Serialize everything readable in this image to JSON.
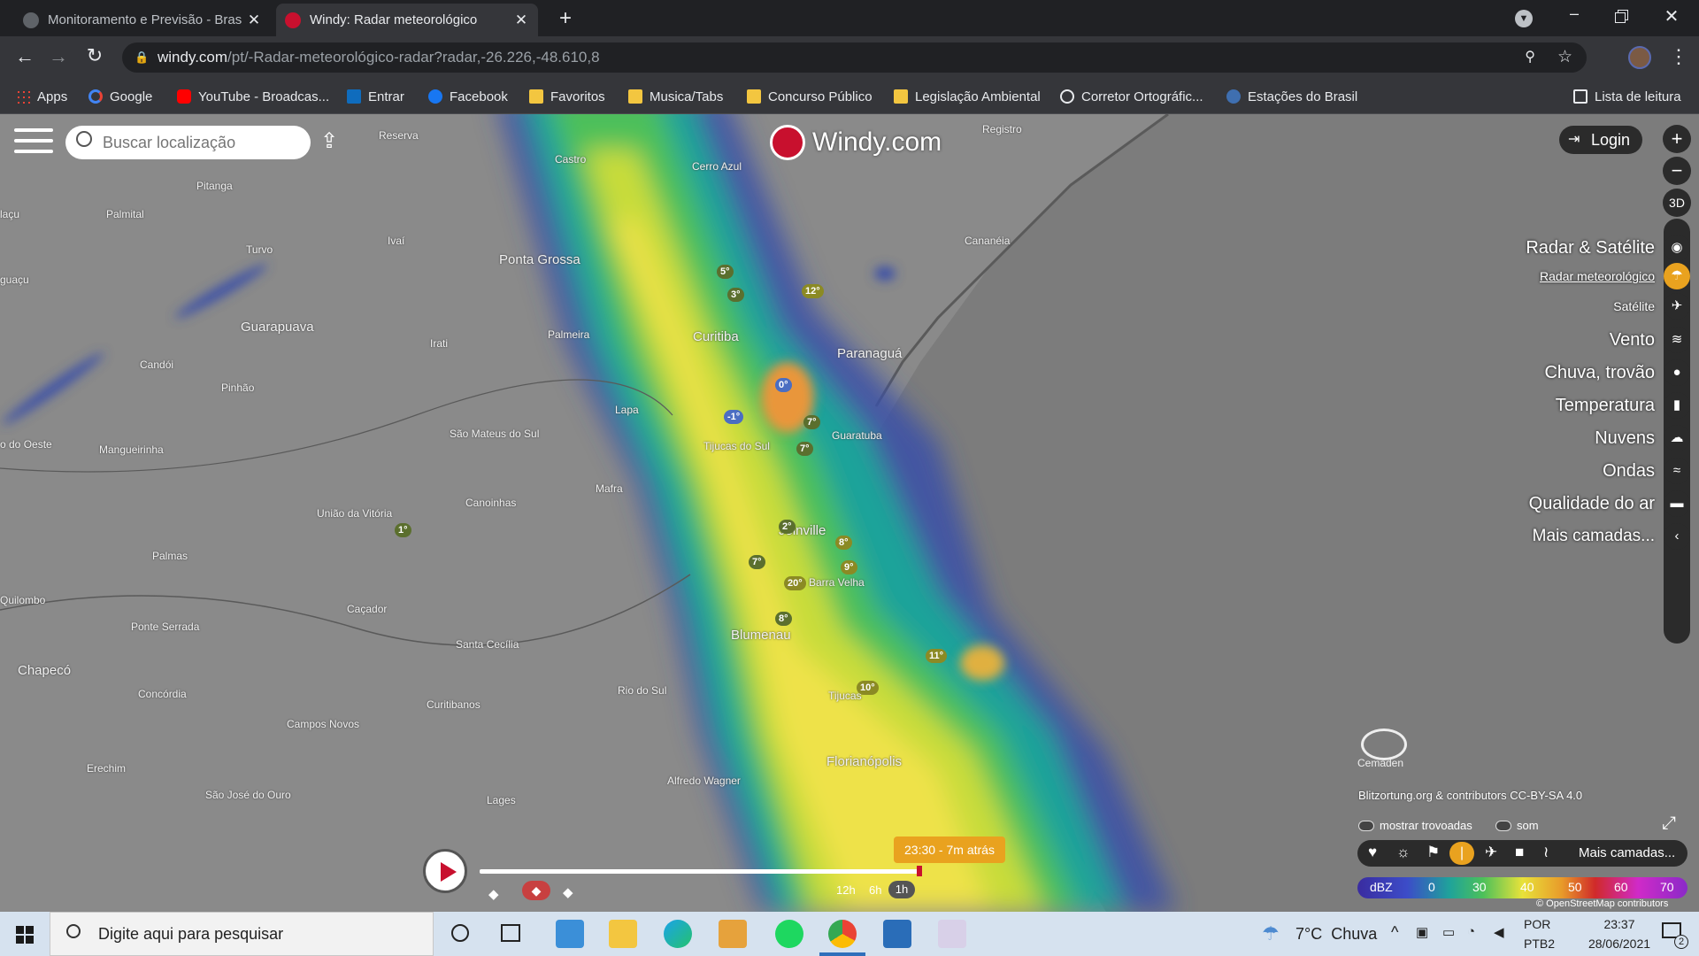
{
  "browser": {
    "tabs": [
      {
        "title": "Monitoramento e Previsão - Bras",
        "active": false
      },
      {
        "title": "Windy: Radar meteorológico",
        "active": true
      }
    ],
    "new_tab_label": "+",
    "url_host": "windy.com",
    "url_path": "/pt/-Radar-meteorológico-radar?radar,-26.226,-48.610,8",
    "bookmarks": [
      "Apps",
      "Google",
      "YouTube - Broadcas...",
      "Entrar",
      "Facebook",
      "Favoritos",
      "Musica/Tabs",
      "Concurso Público",
      "Legislação Ambiental",
      "Corretor Ortográfic...",
      "Estações do Brasil"
    ],
    "reading_list": "Lista de leitura"
  },
  "windy": {
    "search_placeholder": "Buscar localização",
    "logo": "Windy.com",
    "login_label": "Login",
    "zoom_in": "+",
    "zoom_out": "−",
    "three_d": "3D",
    "layers": [
      {
        "label": "Radar & Satélite",
        "icon": "globe-icon"
      },
      {
        "label": "Radar meteorológico",
        "icon": "radar-icon",
        "selected": true
      },
      {
        "label": "Satélite",
        "icon": "satellite-icon"
      },
      {
        "label": "Vento",
        "icon": "wind-icon"
      },
      {
        "label": "Chuva, trovão",
        "icon": "raindrop-icon"
      },
      {
        "label": "Temperatura",
        "icon": "thermometer-icon"
      },
      {
        "label": "Nuvens",
        "icon": "cloud-icon"
      },
      {
        "label": "Ondas",
        "icon": "waves-icon"
      },
      {
        "label": "Qualidade do ar",
        "icon": "car-icon"
      },
      {
        "label": "Mais camadas...",
        "icon": "chevron-left-icon"
      }
    ],
    "cemaden_label": "Cemaden",
    "attribution": "Blitzortung.org & contributors CC-BY-SA 4.0",
    "toggle_thunder": "mostrar trovoadas",
    "toggle_sound": "som",
    "bottom_more_layers": "Mais camadas...",
    "legend": {
      "unit": "dBZ",
      "ticks": [
        "0",
        "30",
        "40",
        "50",
        "60",
        "70"
      ]
    },
    "osm": "© OpenStreetMap contributors",
    "time_bubble": "23:30 - 7m atrás",
    "time_ranges": [
      "12h",
      "6h",
      "1h"
    ],
    "cities": [
      {
        "name": "Registro",
        "big": false
      },
      {
        "name": "Reserva",
        "big": false
      },
      {
        "name": "Castro",
        "big": false
      },
      {
        "name": "Cerro Azul",
        "big": false
      },
      {
        "name": "Pitanga",
        "big": false
      },
      {
        "name": "Palmital",
        "big": false
      },
      {
        "name": "Ivaí",
        "big": false
      },
      {
        "name": "Turvo",
        "big": false
      },
      {
        "name": "Ponta Grossa",
        "big": true
      },
      {
        "name": "Cananéia",
        "big": false
      },
      {
        "name": "Guarapuava",
        "big": true
      },
      {
        "name": "Palmeira",
        "big": false
      },
      {
        "name": "Irati",
        "big": false
      },
      {
        "name": "Curitiba",
        "big": true
      },
      {
        "name": "Paranaguá",
        "big": true
      },
      {
        "name": "Candói",
        "big": false
      },
      {
        "name": "Pinhão",
        "big": false
      },
      {
        "name": "Lapa",
        "big": false
      },
      {
        "name": "São Mateus do Sul",
        "big": false
      },
      {
        "name": "Guaratuba",
        "big": false
      },
      {
        "name": "Mangueirinha",
        "big": false
      },
      {
        "name": "Tijucas do Sul",
        "big": false
      },
      {
        "name": "Mafra",
        "big": false
      },
      {
        "name": "Canoinhas",
        "big": false
      },
      {
        "name": "União da Vitória",
        "big": false
      },
      {
        "name": "Joinville",
        "big": true
      },
      {
        "name": "Palmas",
        "big": false
      },
      {
        "name": "Barra Velha",
        "big": false
      },
      {
        "name": "Caçador",
        "big": false
      },
      {
        "name": "Quilombo",
        "big": false
      },
      {
        "name": "Ponte Serrada",
        "big": false
      },
      {
        "name": "Santa Cecília",
        "big": false
      },
      {
        "name": "Blumenau",
        "big": true
      },
      {
        "name": "Chapecó",
        "big": true
      },
      {
        "name": "Rio do Sul",
        "big": false
      },
      {
        "name": "Concórdia",
        "big": false
      },
      {
        "name": "Tijucas",
        "big": false
      },
      {
        "name": "Curitibanos",
        "big": false
      },
      {
        "name": "Campos Novos",
        "big": false
      },
      {
        "name": "Florianópolis",
        "big": true
      },
      {
        "name": "Erechim",
        "big": false
      },
      {
        "name": "Alfredo Wagner",
        "big": false
      },
      {
        "name": "São José do Ouro",
        "big": false
      },
      {
        "name": "Lages",
        "big": false
      },
      {
        "name": "laçu",
        "big": false
      },
      {
        "name": "guaçu",
        "big": false
      },
      {
        "name": "o do Oeste",
        "big": false
      }
    ],
    "temps": [
      "5°",
      "3°",
      "12°",
      "0°",
      "-1°",
      "7°",
      "7°",
      "2°",
      "8°",
      "9°",
      "7°",
      "20°",
      "8°",
      "11°",
      "10°",
      "1°"
    ]
  },
  "taskbar": {
    "search_placeholder": "Digite aqui para pesquisar",
    "weather": "7°C  Chuva",
    "lang1": "POR",
    "lang2": "PTB2",
    "time": "23:37",
    "date": "28/06/2021",
    "notif_count": "2"
  }
}
